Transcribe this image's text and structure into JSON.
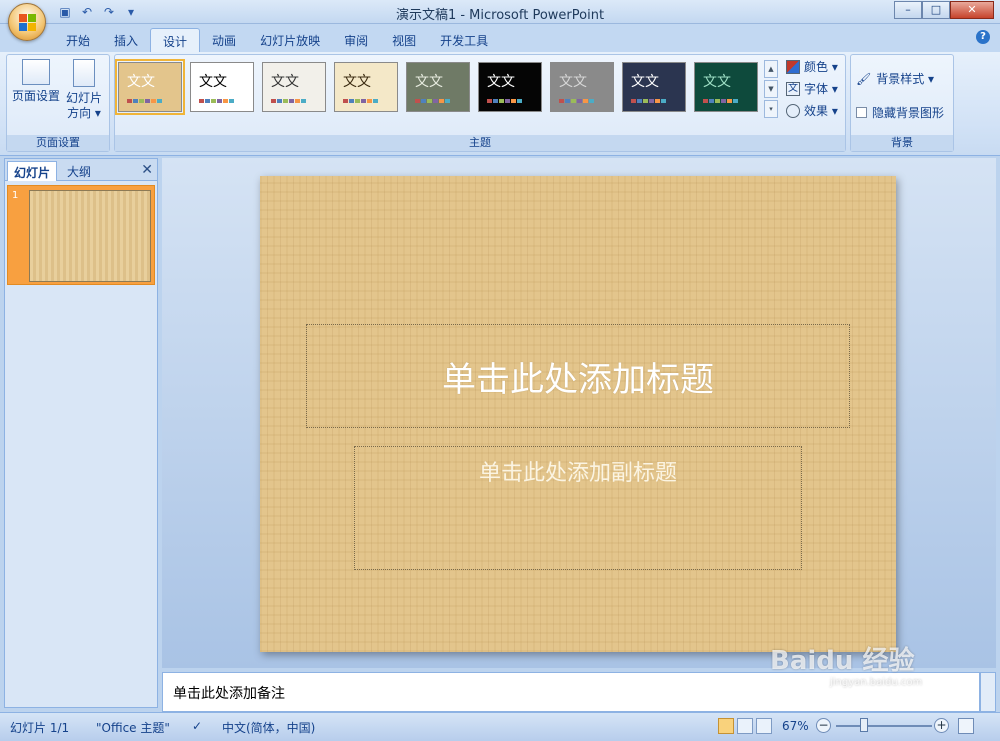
{
  "window": {
    "title": "演示文稿1 - Microsoft PowerPoint",
    "minimize": "–",
    "maximize": "□",
    "close": "✕"
  },
  "quick_access": {
    "save_icon": "save-icon",
    "undo_icon": "undo-icon",
    "redo_icon": "redo-icon"
  },
  "tabs": [
    {
      "label": "开始"
    },
    {
      "label": "插入"
    },
    {
      "label": "设计",
      "active": true
    },
    {
      "label": "动画"
    },
    {
      "label": "幻灯片放映"
    },
    {
      "label": "审阅"
    },
    {
      "label": "视图"
    },
    {
      "label": "开发工具"
    }
  ],
  "ribbon": {
    "page_setup": {
      "label": "页面设置",
      "page_setup_button": "页面设置",
      "orientation_line1": "幻灯片",
      "orientation_line2": "方向 ▾"
    },
    "themes": {
      "label": "主题",
      "items": [
        {
          "text": "文文",
          "bg": "#e3c58c",
          "fg": "#ffffff"
        },
        {
          "text": "文文",
          "bg": "#ffffff",
          "fg": "#000000"
        },
        {
          "text": "文文",
          "bg": "#f2f0ea",
          "fg": "#333333"
        },
        {
          "text": "文文",
          "bg": "#f4e8c8",
          "fg": "#3a2a10"
        },
        {
          "text": "文文",
          "bg": "#6f7a66",
          "fg": "#e8ece0"
        },
        {
          "text": "文文",
          "bg": "#050505",
          "fg": "#ffffff"
        },
        {
          "text": "文文",
          "bg": "#8a8a8a",
          "fg": "#d7d7d7"
        },
        {
          "text": "文文",
          "bg": "#2b3550",
          "fg": "#ffffff"
        },
        {
          "text": "文文",
          "bg": "#0e4a3c",
          "fg": "#9fe0c6"
        }
      ],
      "colors_label": "颜色 ▾",
      "fonts_label": "字体 ▾",
      "effects_label": "效果 ▾"
    },
    "background": {
      "label": "背景",
      "styles_label": "背景样式 ▾",
      "hide_graphics_label": "隐藏背景图形"
    }
  },
  "left_panel": {
    "tab_slides": "幻灯片",
    "tab_outline": "大纲",
    "close": "✕",
    "thumb_number": "1"
  },
  "slide": {
    "title_placeholder": "单击此处添加标题",
    "subtitle_placeholder": "单击此处添加副标题"
  },
  "notes": {
    "placeholder": "单击此处添加备注"
  },
  "status_bar": {
    "slide_info": "幻灯片 1/1",
    "theme_name": "\"Office 主题\"",
    "language": "中文(简体，中国)",
    "zoom": "67%",
    "zoom_minus": "−",
    "zoom_plus": "+"
  },
  "watermark": {
    "text": "Baidu 经验",
    "sub": "jingyan.baidu.com"
  },
  "colors": {
    "accent_orange": "#f8a040",
    "ribbon_blue": "#15428b"
  }
}
